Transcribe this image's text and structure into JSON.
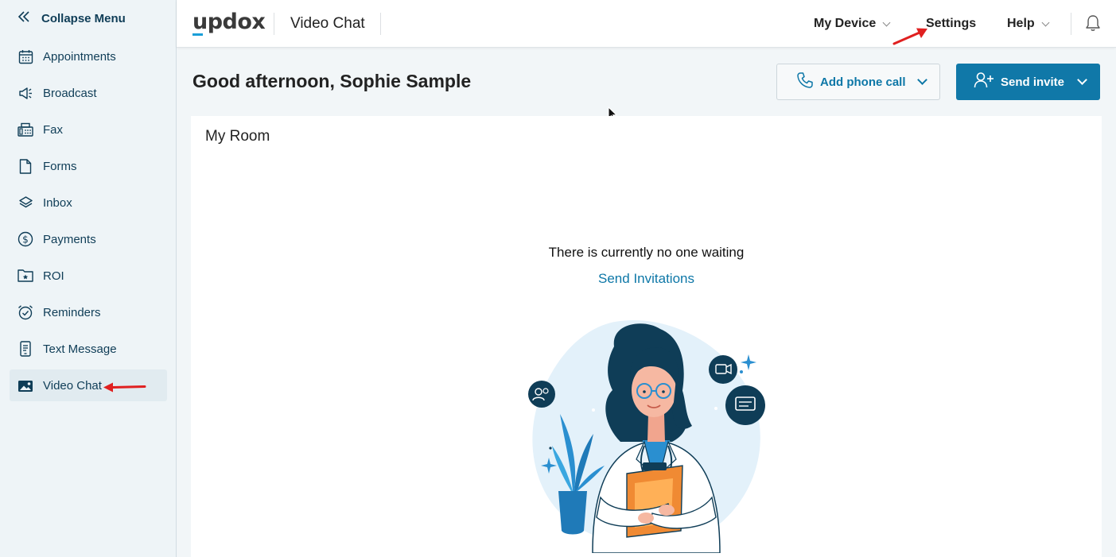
{
  "sidebar": {
    "collapse_label": "Collapse Menu",
    "items": [
      {
        "label": "Appointments",
        "icon": "calendar-icon"
      },
      {
        "label": "Broadcast",
        "icon": "megaphone-icon"
      },
      {
        "label": "Fax",
        "icon": "fax-icon"
      },
      {
        "label": "Forms",
        "icon": "document-icon"
      },
      {
        "label": "Inbox",
        "icon": "layers-icon"
      },
      {
        "label": "Payments",
        "icon": "dollar-icon"
      },
      {
        "label": "ROI",
        "icon": "folder-star-icon"
      },
      {
        "label": "Reminders",
        "icon": "alarm-clock-icon"
      },
      {
        "label": "Text Message",
        "icon": "phone-message-icon"
      },
      {
        "label": "Video Chat",
        "icon": "video-image-icon",
        "active": true
      }
    ]
  },
  "header": {
    "logo": "updox",
    "app_title": "Video Chat",
    "my_device_label": "My Device",
    "settings_label": "Settings",
    "help_label": "Help"
  },
  "main": {
    "greeting": "Good afternoon, Sophie Sample",
    "add_phone_label": "Add phone call",
    "send_invite_label": "Send invite",
    "room": {
      "title": "My Room",
      "empty_message": "There is currently no one waiting",
      "send_invitations_link": "Send Invitations"
    }
  },
  "colors": {
    "accent": "#1078a8",
    "link": "#0d77a7",
    "navy": "#0f3d57",
    "sidebar_bg": "#eef4f7",
    "annotation_arrow": "#e02020"
  }
}
